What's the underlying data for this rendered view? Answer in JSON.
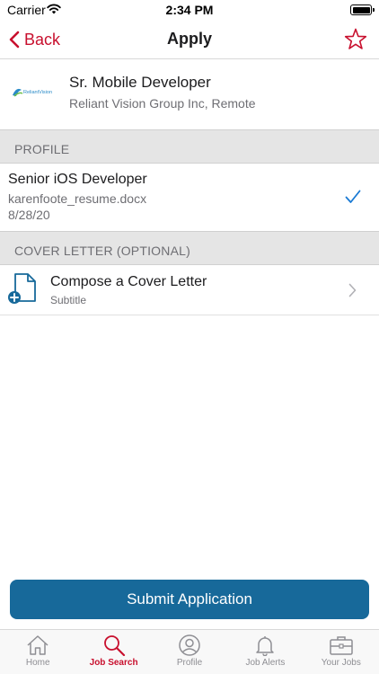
{
  "status_bar": {
    "carrier": "Carrier",
    "time": "2:34 PM",
    "battery_level": 1.0
  },
  "nav": {
    "back_label": "Back",
    "title": "Apply",
    "accent_color": "#c8102e"
  },
  "job": {
    "title": "Sr. Mobile Developer",
    "company_location": "Reliant Vision Group Inc, Remote",
    "logo_text": "ReliantVision"
  },
  "profile_section": {
    "header": "PROFILE",
    "resume_name": "Senior iOS Developer",
    "resume_file": "karenfoote_resume.docx",
    "resume_date": "8/28/20",
    "selected": true
  },
  "cover_section": {
    "header": "COVER LETTER (OPTIONAL)",
    "title": "Compose a Cover Letter",
    "subtitle": "Subtitle"
  },
  "submit": {
    "label": "Submit Application",
    "color": "#17699a"
  },
  "tabs": [
    {
      "label": "Home",
      "icon": "home-icon",
      "active": false
    },
    {
      "label": "Job Search",
      "icon": "search-icon",
      "active": true
    },
    {
      "label": "Profile",
      "icon": "profile-icon",
      "active": false
    },
    {
      "label": "Job Alerts",
      "icon": "bell-icon",
      "active": false
    },
    {
      "label": "Your Jobs",
      "icon": "briefcase-icon",
      "active": false
    }
  ]
}
